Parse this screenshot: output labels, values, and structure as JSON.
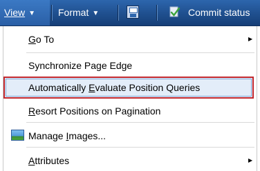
{
  "toolbar": {
    "view_label": "View",
    "format_label": "Format",
    "commit_label": "Commit status",
    "dropdown_glyph": "▼",
    "icons": [
      "save-icon",
      "commit-status-icon"
    ],
    "colors": {
      "bar": "#1f4f8e",
      "text": "#ffffff"
    }
  },
  "menu": {
    "go_to": {
      "pre": "",
      "mn": "G",
      "post": "o To"
    },
    "sync": {
      "pre": "Synchronize Page Edge",
      "mn": "",
      "post": ""
    },
    "auto_eval": {
      "pre": "Automatically ",
      "mn": "E",
      "post": "valuate Position Queries"
    },
    "resort": {
      "pre": "",
      "mn": "R",
      "post": "esort Positions on Pagination"
    },
    "manage_images": {
      "pre": "Manage ",
      "mn": "I",
      "post": "mages..."
    },
    "attributes": {
      "pre": "",
      "mn": "A",
      "post": "ttributes"
    },
    "submenu_glyph": "▶",
    "highlight_color": "#c1272d"
  }
}
